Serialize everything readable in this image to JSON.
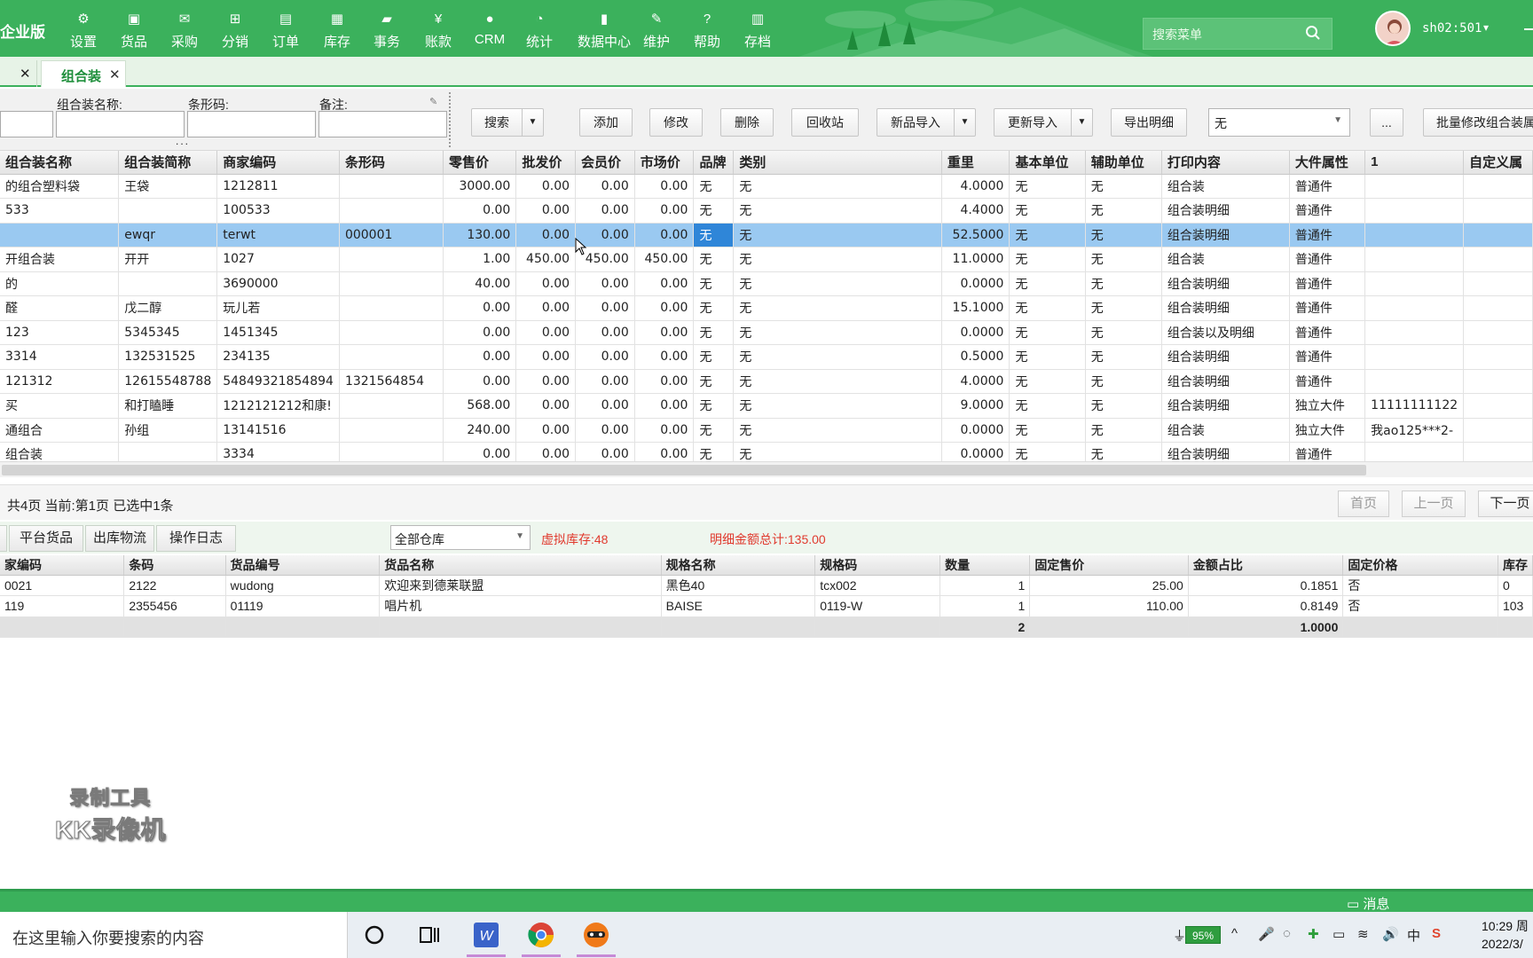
{
  "brand": "企业版",
  "nav": [
    {
      "label": "设置",
      "icon": "gear-icon"
    },
    {
      "label": "货品",
      "icon": "box-icon"
    },
    {
      "label": "采购",
      "icon": "cart-icon"
    },
    {
      "label": "分销",
      "icon": "network-icon"
    },
    {
      "label": "订单",
      "icon": "order-icon"
    },
    {
      "label": "库存",
      "icon": "grid-icon"
    },
    {
      "label": "事务",
      "icon": "chat-icon"
    },
    {
      "label": "账款",
      "icon": "yen-icon"
    },
    {
      "label": "CRM",
      "icon": "person-icon"
    },
    {
      "label": "统计",
      "icon": "pie-icon"
    },
    {
      "label": "数据中心",
      "icon": "bar-chart-icon"
    },
    {
      "label": "维护",
      "icon": "wrench-icon"
    },
    {
      "label": "帮助",
      "icon": "help-icon"
    },
    {
      "label": "存档",
      "icon": "archive-icon"
    }
  ],
  "search_placeholder": "搜索菜单",
  "user": "sh02:501",
  "tabs": {
    "active": "组合装",
    "close": "✕"
  },
  "filters": {
    "name_label": "组合装名称:",
    "barcode_label": "条形码:",
    "remark_label": "备注:",
    "dots": "...",
    "clear": "✎"
  },
  "toolbar": {
    "search": "搜索",
    "add": "添加",
    "edit": "修改",
    "delete": "删除",
    "recycle": "回收站",
    "import_new": "新品导入",
    "import_update": "更新导入",
    "export_detail": "导出明细",
    "select_value": "无",
    "more": "...",
    "batch_edit": "批量修改组合装属"
  },
  "main_table": {
    "headers": [
      "组合装名称",
      "组合装简称",
      "商家编码",
      "条形码",
      "零售价",
      "批发价",
      "会员价",
      "市场价",
      "品牌",
      "类别",
      "重里",
      "基本单位",
      "辅助单位",
      "打印内容",
      "大件属性",
      "1",
      "自定义属"
    ],
    "rows": [
      [
        "的组合塑料袋",
        "王袋",
        "1212811",
        "",
        "3000.00",
        "0.00",
        "0.00",
        "0.00",
        "无",
        "无",
        "4.0000",
        "无",
        "无",
        "组合装",
        "普通件",
        "",
        ""
      ],
      [
        "533",
        "",
        "100533",
        "",
        "0.00",
        "0.00",
        "0.00",
        "0.00",
        "无",
        "无",
        "4.4000",
        "无",
        "无",
        "组合装明细",
        "普通件",
        "",
        ""
      ],
      [
        "",
        "ewqr",
        "terwt",
        "000001",
        "130.00",
        "0.00",
        "0.00",
        "0.00",
        "无",
        "无",
        "52.5000",
        "无",
        "无",
        "组合装明细",
        "普通件",
        "",
        ""
      ],
      [
        "开组合装",
        "开开",
        "1027",
        "",
        "1.00",
        "450.00",
        "450.00",
        "450.00",
        "无",
        "无",
        "11.0000",
        "无",
        "无",
        "组合装",
        "普通件",
        "",
        ""
      ],
      [
        "的",
        "",
        "3690000",
        "",
        "40.00",
        "0.00",
        "0.00",
        "0.00",
        "无",
        "无",
        "0.0000",
        "无",
        "无",
        "组合装明细",
        "普通件",
        "",
        ""
      ],
      [
        "醛",
        "戊二醇",
        "玩儿若",
        "",
        "0.00",
        "0.00",
        "0.00",
        "0.00",
        "无",
        "无",
        "15.1000",
        "无",
        "无",
        "组合装明细",
        "普通件",
        "",
        ""
      ],
      [
        "123",
        "5345345",
        "1451345",
        "",
        "0.00",
        "0.00",
        "0.00",
        "0.00",
        "无",
        "无",
        "0.0000",
        "无",
        "无",
        "组合装以及明细",
        "普通件",
        "",
        ""
      ],
      [
        "3314",
        "132531525",
        "234135",
        "",
        "0.00",
        "0.00",
        "0.00",
        "0.00",
        "无",
        "无",
        "0.5000",
        "无",
        "无",
        "组合装明细",
        "普通件",
        "",
        ""
      ],
      [
        "121312",
        "12615548788",
        "54849321854894",
        "1321564854",
        "0.00",
        "0.00",
        "0.00",
        "0.00",
        "无",
        "无",
        "4.0000",
        "无",
        "无",
        "组合装明细",
        "普通件",
        "",
        ""
      ],
      [
        "买",
        "和打瞌睡",
        "1212121212和康!",
        "",
        "568.00",
        "0.00",
        "0.00",
        "0.00",
        "无",
        "无",
        "9.0000",
        "无",
        "无",
        "组合装明细",
        "独立大件",
        "11111111122",
        ""
      ],
      [
        "通组合",
        "孙组",
        "13141516",
        "",
        "240.00",
        "0.00",
        "0.00",
        "0.00",
        "无",
        "无",
        "0.0000",
        "无",
        "无",
        "组合装",
        "独立大件",
        "我ao125***2-",
        ""
      ],
      [
        "组合装",
        "",
        "3334",
        "",
        "0.00",
        "0.00",
        "0.00",
        "0.00",
        "无",
        "无",
        "0.0000",
        "无",
        "无",
        "组合装明细",
        "普通件",
        "",
        ""
      ]
    ],
    "selected_row": 2
  },
  "pager": {
    "info": "共4页  当前:第1页  已选中1条",
    "first": "首页",
    "prev": "上一页",
    "next": "下一页"
  },
  "detail_tabs": [
    "平台货品",
    "出库物流",
    "操作日志"
  ],
  "warehouse": "全部仓库",
  "virtual_stock": "虚拟库存:48",
  "detail_total": "明细金额总计:135.00",
  "detail_table": {
    "headers": [
      "家编码",
      "条码",
      "货品编号",
      "货品名称",
      "规格名称",
      "规格码",
      "数量",
      "固定售价",
      "金额占比",
      "固定价格",
      "库存"
    ],
    "rows": [
      [
        "0021",
        "2122",
        "wudong",
        "欢迎来到德莱联盟",
        "黑色40",
        "tcx002",
        "1",
        "25.00",
        "0.1851",
        "否",
        "0"
      ],
      [
        "119",
        "2355456",
        "01119",
        "唱片机",
        "BAISE",
        "0119-W",
        "1",
        "110.00",
        "0.8149",
        "否",
        "103"
      ]
    ],
    "sum": [
      "",
      "",
      "",
      "",
      "",
      "",
      "2",
      "",
      "1.0000",
      "",
      ""
    ]
  },
  "watermark": {
    "line1": "录制工具",
    "line2": "KK录像机"
  },
  "status_message": "消息",
  "taskbar": {
    "search": "在这里输入你要搜索的内容",
    "battery": "95%",
    "time": "10:29 周",
    "date": "2022/3/"
  },
  "colors": {
    "brand_green": "#3bb15c",
    "selected_row": "#9ac9f1",
    "alert_red": "#e03a2e"
  }
}
